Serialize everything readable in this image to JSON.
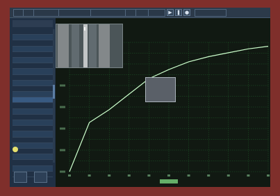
{
  "menubar": {
    "items": [
      "",
      "",
      "",
      "",
      "",
      "",
      "",
      "",
      "",
      "",
      "",
      "",
      ""
    ],
    "icons": [
      "play-icon",
      "pause-icon",
      "record-icon"
    ]
  },
  "sidebar": {
    "header": "",
    "rows": [
      [
        "",
        ""
      ],
      [
        "",
        ""
      ],
      [
        "",
        ""
      ],
      [
        "",
        ""
      ],
      [
        "",
        ""
      ],
      [
        "",
        ""
      ],
      [
        "",
        ""
      ],
      [
        "",
        ""
      ],
      [
        "",
        ""
      ],
      [
        "",
        ""
      ],
      [
        "",
        ""
      ],
      [
        "",
        ""
      ],
      [
        "",
        ""
      ],
      [
        "",
        ""
      ],
      [
        "",
        ""
      ],
      [
        "",
        ""
      ],
      [
        "",
        ""
      ],
      [
        "",
        ""
      ],
      [
        "",
        ""
      ],
      [
        "",
        ""
      ],
      [
        "",
        ""
      ],
      [
        "",
        ""
      ],
      [
        "",
        ""
      ],
      [
        "",
        ""
      ],
      [
        "",
        ""
      ],
      [
        "",
        ""
      ]
    ],
    "buttons": [
      "",
      ""
    ]
  },
  "preview": {
    "title": ""
  },
  "overlay": {
    "lines": [
      "",
      "",
      ""
    ]
  },
  "chart_data": {
    "type": "line",
    "title": "",
    "xlabel": "",
    "ylabel": "",
    "x": [
      0,
      0.1,
      0.2,
      0.3,
      0.4,
      0.5,
      0.6,
      0.7,
      0.8,
      0.9,
      1.0
    ],
    "series": [
      {
        "values": [
          0,
          0.38,
          0.48,
          0.6,
          0.72,
          0.79,
          0.85,
          0.89,
          0.92,
          0.95,
          0.97
        ]
      }
    ],
    "xlim": [
      0,
      1
    ],
    "ylim": [
      0,
      1
    ],
    "grid": true,
    "legend": "none"
  }
}
